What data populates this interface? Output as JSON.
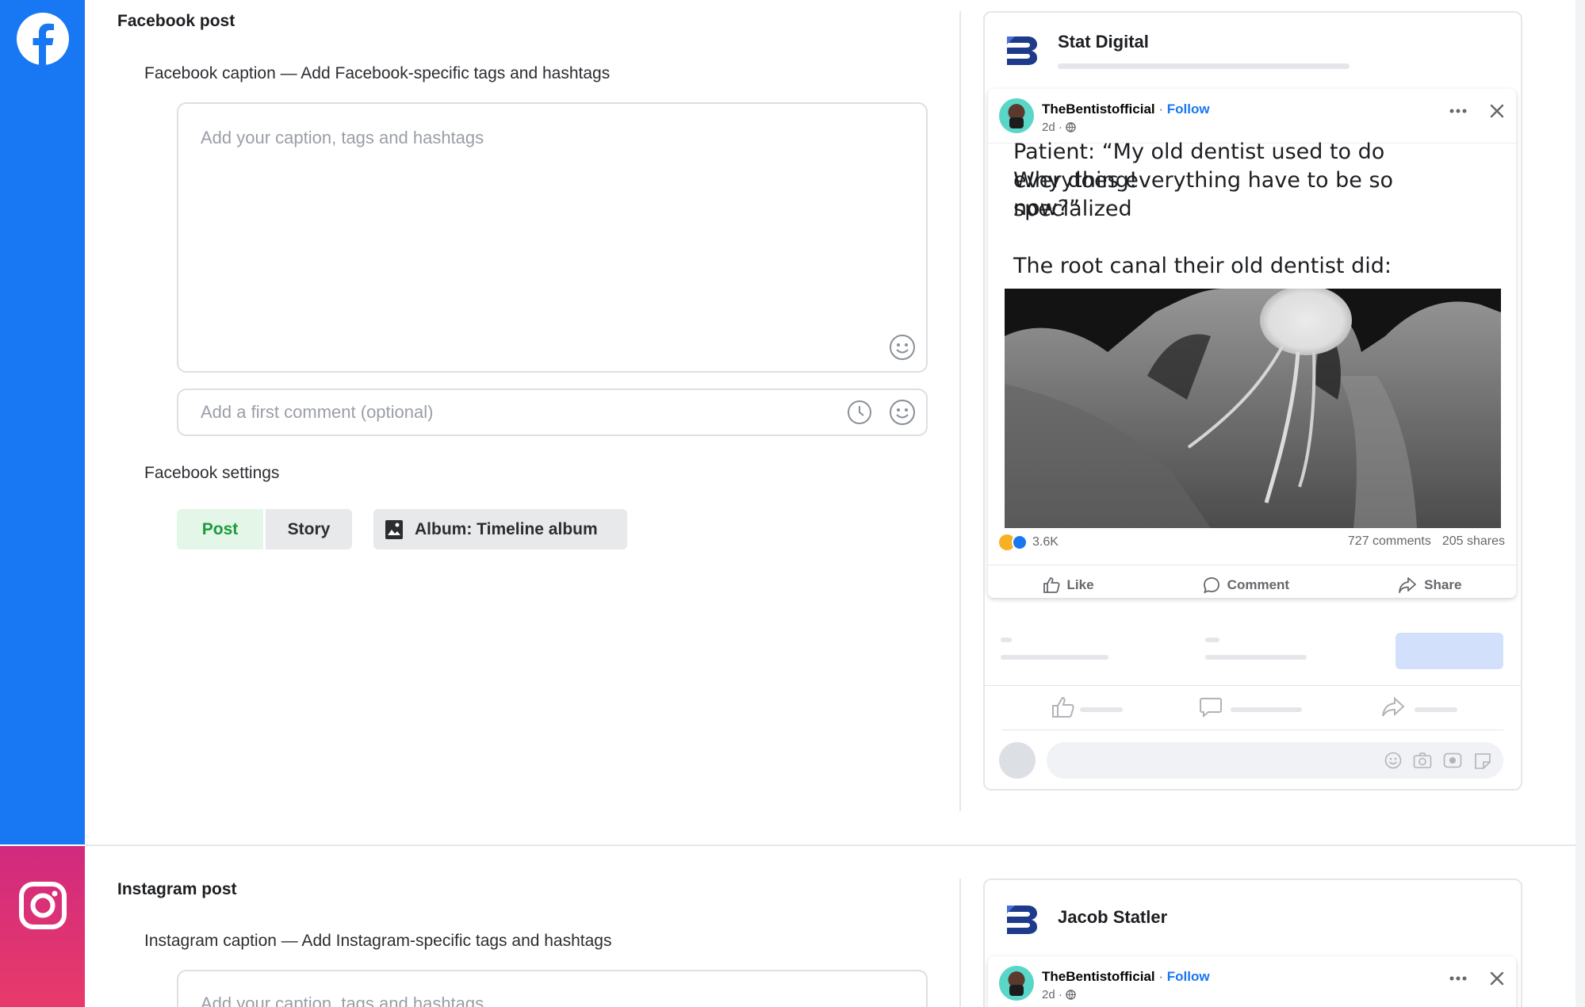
{
  "facebook": {
    "section_title": "Facebook post",
    "caption_label": "Facebook caption — Add Facebook-specific tags and hashtags",
    "caption_placeholder": "Add your caption, tags and hashtags",
    "comment_placeholder": "Add a first comment (optional)",
    "settings_label": "Facebook settings",
    "post_label": "Post",
    "story_label": "Story",
    "album_label": "Album: Timeline album",
    "brand_color": "#1877f2"
  },
  "facebook_preview": {
    "page_name": "Stat Digital",
    "author": "TheBentistofficial",
    "follow": "Follow",
    "separator": " · ",
    "time": "2d ·",
    "text_line1": "Patient: “My old dentist used to do everything!",
    "text_line2": "Why does everything have to be so specialized",
    "text_line3": "now?”",
    "text_line4": "The root canal their old dentist did:",
    "reactions": "3.6K",
    "comments": "727 comments",
    "shares": "205 shares",
    "like": "Like",
    "comment": "Comment",
    "share": "Share"
  },
  "instagram": {
    "section_title": "Instagram post",
    "caption_label": "Instagram caption — Add Instagram-specific tags and hashtags",
    "caption_placeholder": "Add your caption, tags and hashtags",
    "brand_color": "#d62976"
  },
  "instagram_preview": {
    "page_name": "Jacob Statler",
    "author": "TheBentistofficial",
    "follow": "Follow",
    "separator": " · ",
    "time": "2d ·"
  },
  "icons": {
    "facebook": "facebook-logo-icon",
    "instagram": "instagram-logo-icon",
    "emoji": "smiley-icon",
    "schedule": "clock-icon",
    "album": "album-icon",
    "more": "ellipsis-icon",
    "close": "close-icon"
  }
}
